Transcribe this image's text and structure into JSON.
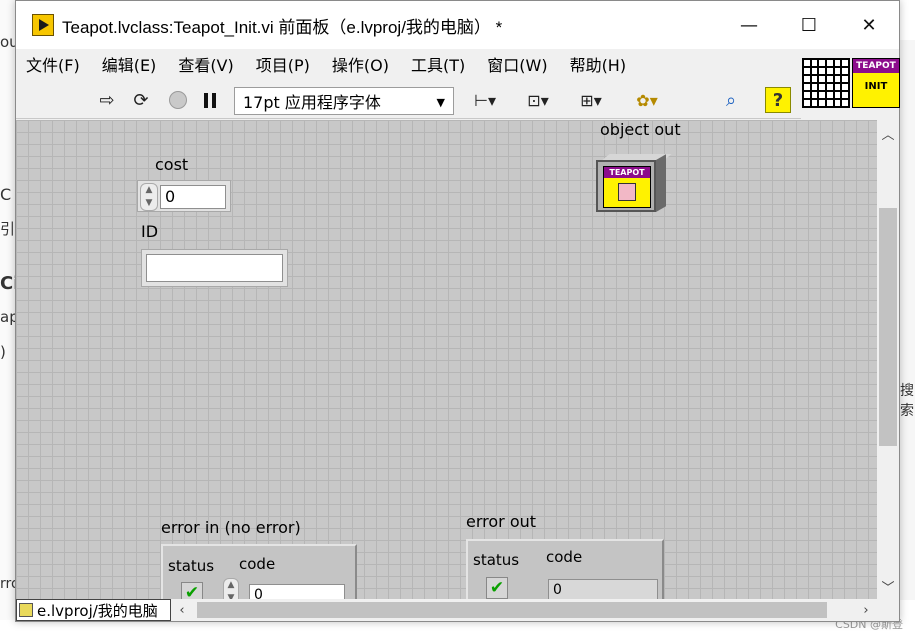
{
  "window": {
    "title": "Teapot.lvclass:Teapot_Init.vi 前面板（e.lvproj/我的电脑） *",
    "min_glyph": "—",
    "max_glyph": "☐",
    "close_glyph": "✕"
  },
  "menu": [
    "文件(F)",
    "编辑(E)",
    "查看(V)",
    "项目(P)",
    "操作(O)",
    "工具(T)",
    "窗口(W)",
    "帮助(H)"
  ],
  "toolbar": {
    "font": "17pt 应用程序字体",
    "help": "?"
  },
  "icon": {
    "banner": "TEAPOT",
    "text": "INIT"
  },
  "panel": {
    "cost": {
      "label": "cost",
      "value": "0"
    },
    "id": {
      "label": "ID",
      "value": ""
    },
    "object_out": {
      "label": "object out",
      "banner": "TEAPOT"
    },
    "error_in": {
      "label": "error in (no error)",
      "status_label": "status",
      "code_label": "code",
      "code_value": "0"
    },
    "error_out": {
      "label": "error out",
      "status_label": "status",
      "code_label": "code",
      "code_value": "0"
    }
  },
  "status_bar": {
    "path": "e.lvproj/我的电脑"
  },
  "background": {
    "fragments": [
      "ou",
      "C",
      "引",
      "Ci",
      "ap",
      ")",
      "rro"
    ],
    "right_fragment": "搜索"
  },
  "watermark": "CSDN @斯登",
  "colors": {
    "panel_grid": "#c8c8c8",
    "help_yellow": "#fff200",
    "banner_purple": "#8c0c8c"
  }
}
